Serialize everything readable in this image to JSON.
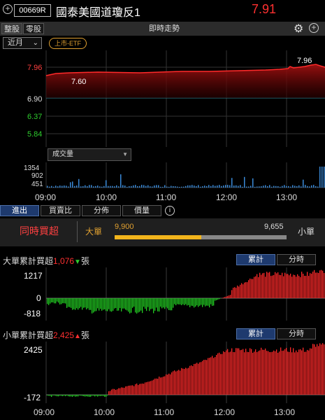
{
  "header": {
    "stock_code": "00669R",
    "stock_name": "國泰美國道瓊反1",
    "price": "7.91"
  },
  "toolbar": {
    "tabs": [
      {
        "label": "整股",
        "active": true
      },
      {
        "label": "零股",
        "active": false
      }
    ],
    "title": "即時走勢"
  },
  "period_select": {
    "value": "近月",
    "icon": "chevron-down-icon"
  },
  "badge": "上市-ETF",
  "price_chart": {
    "y_ticks": [
      {
        "label": "7.96",
        "color": "#ff4040"
      },
      {
        "label": "6.90",
        "color": "#dddddd"
      },
      {
        "label": "6.37",
        "color": "#2ecc2e"
      },
      {
        "label": "5.84",
        "color": "#2ecc2e"
      }
    ],
    "annotations": {
      "low": "7.60",
      "high": "7.96"
    }
  },
  "volume_chart": {
    "select_label": "成交量",
    "y_ticks": [
      "1354",
      "902",
      "451"
    ]
  },
  "x_ticks": [
    "09:00",
    "10:00",
    "11:00",
    "12:00",
    "13:00"
  ],
  "flow_tabs": [
    {
      "label": "進出",
      "active": true
    },
    {
      "label": "買賣比",
      "active": false
    },
    {
      "label": "分佈",
      "active": false
    },
    {
      "label": "價量",
      "active": false
    }
  ],
  "buy_sell": {
    "label": "同時買超",
    "big_label": "大單",
    "small_label": "小單",
    "big_value": "9,900",
    "small_value": "9,655",
    "big_ratio": 0.506
  },
  "big_order": {
    "title_prefix": "大單累計買超",
    "value": "1,076",
    "unit": "張",
    "seg": [
      "累計",
      "分時"
    ],
    "y_ticks": [
      "1217",
      "0",
      "-818"
    ]
  },
  "small_order": {
    "title_prefix": "小單累計買超",
    "value": "2,425",
    "unit": "張",
    "seg": [
      "累計",
      "分時"
    ],
    "y_ticks": [
      "2425",
      "-172"
    ]
  },
  "colors": {
    "up": "#ff3030",
    "down": "#22cc22",
    "accent": "#e0a030",
    "grid": "#444444"
  }
}
